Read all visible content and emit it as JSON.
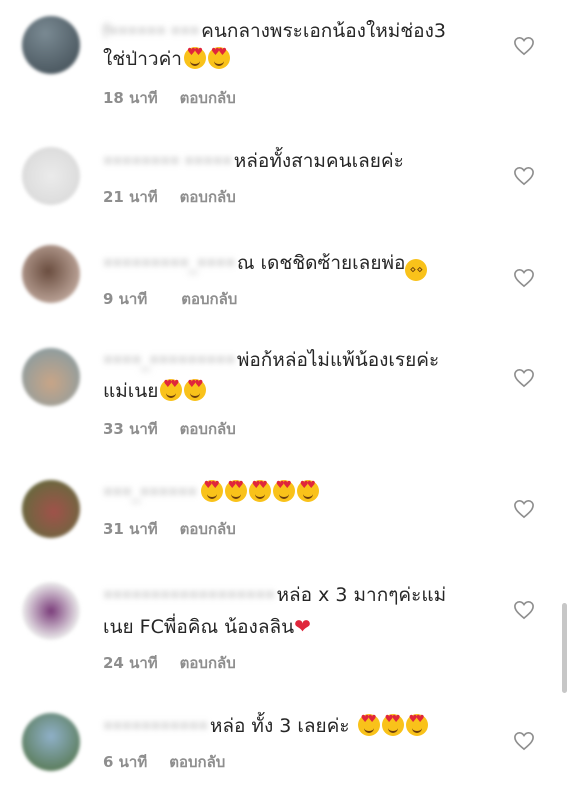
{
  "comments": [
    {
      "username": "f•••••• •••",
      "text1": "คนกลางพระเอกน้องใหม่ช่อง3",
      "text2": "ใช่ป่าวค่า",
      "time": "18 นาที",
      "reply": "ตอบกลับ",
      "emojis": "heart-eyes x2",
      "avatar_color": "#5a6a74"
    },
    {
      "username": "•••••••• •••••",
      "text1": "หล่อทั้งสามคนเลยค่ะ",
      "time": "21 นาที",
      "reply": "ตอบกลับ",
      "avatar_color": "#e2e2e2"
    },
    {
      "username": "•••••••••_••••",
      "text1": "ณ เดชชิดซ้ายเลยพ่อ",
      "time": "9 นาที",
      "reply": "ตอบกลับ",
      "emojis": "laughing",
      "avatar_color": "#a58a78"
    },
    {
      "username": "••••_•••••••••",
      "text1": "พ่อก้หล่อไม่แพ้น้องเรยค่ะ",
      "text2": "แม่เนย",
      "time": "33 นาที",
      "reply": "ตอบกลับ",
      "emojis": "heart-eyes x2",
      "avatar_color": "#8fa6ad"
    },
    {
      "username": "•••_••••••",
      "text1": "",
      "time": "31 นาที",
      "reply": "ตอบกลับ",
      "emojis": "heart-eyes x5",
      "avatar_color": "#6f7d4e"
    },
    {
      "username": "••••••••••••••••••",
      "text1": "หล่อ x 3 มากๆค่ะแม่",
      "text2": "เนย  FCพี่อคิณ น้องลลิน",
      "time": "24 นาที",
      "reply": "ตอบกลับ",
      "emojis": "red-heart",
      "avatar_color": "#b7a6b4"
    },
    {
      "username": "•••••••••••",
      "text1": "หล่อ ทั้ง 3 เลยค่ะ",
      "time": "6 นาที",
      "reply": "ตอบกลับ",
      "emojis": "heart-eyes x3",
      "avatar_color": "#6e8a5c"
    }
  ],
  "icons": {
    "like": "heart-outline-icon"
  }
}
